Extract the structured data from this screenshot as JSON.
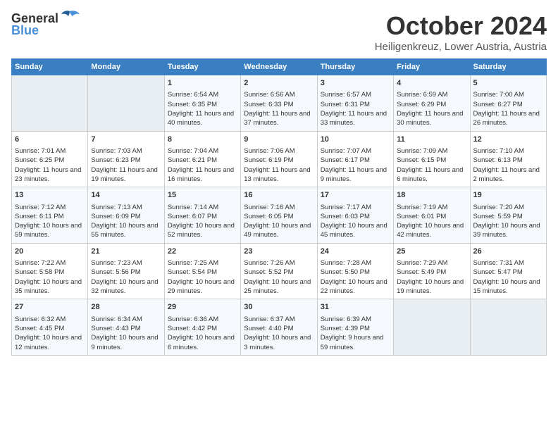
{
  "header": {
    "logo_general": "General",
    "logo_blue": "Blue",
    "month": "October 2024",
    "location": "Heiligenkreuz, Lower Austria, Austria"
  },
  "weekdays": [
    "Sunday",
    "Monday",
    "Tuesday",
    "Wednesday",
    "Thursday",
    "Friday",
    "Saturday"
  ],
  "weeks": [
    [
      {
        "day": "",
        "empty": true
      },
      {
        "day": "",
        "empty": true
      },
      {
        "day": "1",
        "sunrise": "Sunrise: 6:54 AM",
        "sunset": "Sunset: 6:35 PM",
        "daylight": "Daylight: 11 hours and 40 minutes."
      },
      {
        "day": "2",
        "sunrise": "Sunrise: 6:56 AM",
        "sunset": "Sunset: 6:33 PM",
        "daylight": "Daylight: 11 hours and 37 minutes."
      },
      {
        "day": "3",
        "sunrise": "Sunrise: 6:57 AM",
        "sunset": "Sunset: 6:31 PM",
        "daylight": "Daylight: 11 hours and 33 minutes."
      },
      {
        "day": "4",
        "sunrise": "Sunrise: 6:59 AM",
        "sunset": "Sunset: 6:29 PM",
        "daylight": "Daylight: 11 hours and 30 minutes."
      },
      {
        "day": "5",
        "sunrise": "Sunrise: 7:00 AM",
        "sunset": "Sunset: 6:27 PM",
        "daylight": "Daylight: 11 hours and 26 minutes."
      }
    ],
    [
      {
        "day": "6",
        "sunrise": "Sunrise: 7:01 AM",
        "sunset": "Sunset: 6:25 PM",
        "daylight": "Daylight: 11 hours and 23 minutes."
      },
      {
        "day": "7",
        "sunrise": "Sunrise: 7:03 AM",
        "sunset": "Sunset: 6:23 PM",
        "daylight": "Daylight: 11 hours and 19 minutes."
      },
      {
        "day": "8",
        "sunrise": "Sunrise: 7:04 AM",
        "sunset": "Sunset: 6:21 PM",
        "daylight": "Daylight: 11 hours and 16 minutes."
      },
      {
        "day": "9",
        "sunrise": "Sunrise: 7:06 AM",
        "sunset": "Sunset: 6:19 PM",
        "daylight": "Daylight: 11 hours and 13 minutes."
      },
      {
        "day": "10",
        "sunrise": "Sunrise: 7:07 AM",
        "sunset": "Sunset: 6:17 PM",
        "daylight": "Daylight: 11 hours and 9 minutes."
      },
      {
        "day": "11",
        "sunrise": "Sunrise: 7:09 AM",
        "sunset": "Sunset: 6:15 PM",
        "daylight": "Daylight: 11 hours and 6 minutes."
      },
      {
        "day": "12",
        "sunrise": "Sunrise: 7:10 AM",
        "sunset": "Sunset: 6:13 PM",
        "daylight": "Daylight: 11 hours and 2 minutes."
      }
    ],
    [
      {
        "day": "13",
        "sunrise": "Sunrise: 7:12 AM",
        "sunset": "Sunset: 6:11 PM",
        "daylight": "Daylight: 10 hours and 59 minutes."
      },
      {
        "day": "14",
        "sunrise": "Sunrise: 7:13 AM",
        "sunset": "Sunset: 6:09 PM",
        "daylight": "Daylight: 10 hours and 55 minutes."
      },
      {
        "day": "15",
        "sunrise": "Sunrise: 7:14 AM",
        "sunset": "Sunset: 6:07 PM",
        "daylight": "Daylight: 10 hours and 52 minutes."
      },
      {
        "day": "16",
        "sunrise": "Sunrise: 7:16 AM",
        "sunset": "Sunset: 6:05 PM",
        "daylight": "Daylight: 10 hours and 49 minutes."
      },
      {
        "day": "17",
        "sunrise": "Sunrise: 7:17 AM",
        "sunset": "Sunset: 6:03 PM",
        "daylight": "Daylight: 10 hours and 45 minutes."
      },
      {
        "day": "18",
        "sunrise": "Sunrise: 7:19 AM",
        "sunset": "Sunset: 6:01 PM",
        "daylight": "Daylight: 10 hours and 42 minutes."
      },
      {
        "day": "19",
        "sunrise": "Sunrise: 7:20 AM",
        "sunset": "Sunset: 5:59 PM",
        "daylight": "Daylight: 10 hours and 39 minutes."
      }
    ],
    [
      {
        "day": "20",
        "sunrise": "Sunrise: 7:22 AM",
        "sunset": "Sunset: 5:58 PM",
        "daylight": "Daylight: 10 hours and 35 minutes."
      },
      {
        "day": "21",
        "sunrise": "Sunrise: 7:23 AM",
        "sunset": "Sunset: 5:56 PM",
        "daylight": "Daylight: 10 hours and 32 minutes."
      },
      {
        "day": "22",
        "sunrise": "Sunrise: 7:25 AM",
        "sunset": "Sunset: 5:54 PM",
        "daylight": "Daylight: 10 hours and 29 minutes."
      },
      {
        "day": "23",
        "sunrise": "Sunrise: 7:26 AM",
        "sunset": "Sunset: 5:52 PM",
        "daylight": "Daylight: 10 hours and 25 minutes."
      },
      {
        "day": "24",
        "sunrise": "Sunrise: 7:28 AM",
        "sunset": "Sunset: 5:50 PM",
        "daylight": "Daylight: 10 hours and 22 minutes."
      },
      {
        "day": "25",
        "sunrise": "Sunrise: 7:29 AM",
        "sunset": "Sunset: 5:49 PM",
        "daylight": "Daylight: 10 hours and 19 minutes."
      },
      {
        "day": "26",
        "sunrise": "Sunrise: 7:31 AM",
        "sunset": "Sunset: 5:47 PM",
        "daylight": "Daylight: 10 hours and 15 minutes."
      }
    ],
    [
      {
        "day": "27",
        "sunrise": "Sunrise: 6:32 AM",
        "sunset": "Sunset: 4:45 PM",
        "daylight": "Daylight: 10 hours and 12 minutes."
      },
      {
        "day": "28",
        "sunrise": "Sunrise: 6:34 AM",
        "sunset": "Sunset: 4:43 PM",
        "daylight": "Daylight: 10 hours and 9 minutes."
      },
      {
        "day": "29",
        "sunrise": "Sunrise: 6:36 AM",
        "sunset": "Sunset: 4:42 PM",
        "daylight": "Daylight: 10 hours and 6 minutes."
      },
      {
        "day": "30",
        "sunrise": "Sunrise: 6:37 AM",
        "sunset": "Sunset: 4:40 PM",
        "daylight": "Daylight: 10 hours and 3 minutes."
      },
      {
        "day": "31",
        "sunrise": "Sunrise: 6:39 AM",
        "sunset": "Sunset: 4:39 PM",
        "daylight": "Daylight: 9 hours and 59 minutes."
      },
      {
        "day": "",
        "empty": true
      },
      {
        "day": "",
        "empty": true
      }
    ]
  ]
}
